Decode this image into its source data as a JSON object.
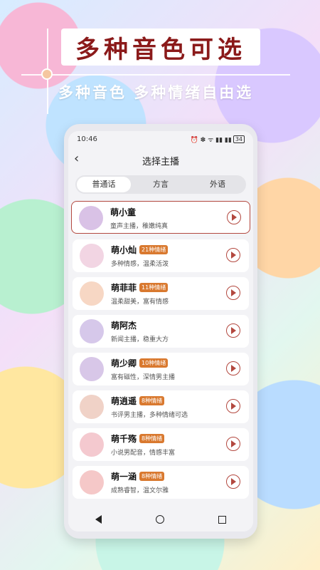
{
  "hero": {
    "title": "多种音色可选",
    "subtitle": "多种音色  多种情绪自由选"
  },
  "status_bar": {
    "time": "10:46",
    "icons": "⏰ ✽ ᯤ ▮▮ ▮▮",
    "battery": "34"
  },
  "nav": {
    "title": "选择主播",
    "back_icon": "‹"
  },
  "tabs": [
    {
      "label": "普通话",
      "active": true
    },
    {
      "label": "方言",
      "active": false
    },
    {
      "label": "外语",
      "active": false
    }
  ],
  "anchors": [
    {
      "name": "萌小童",
      "badge": "",
      "desc": "童声主播，稚嫩纯真",
      "selected": true
    },
    {
      "name": "萌小灿",
      "badge": "21种情绪",
      "desc": "多种情感，温柔活泼",
      "selected": false
    },
    {
      "name": "萌菲菲",
      "badge": "11种情绪",
      "desc": "温柔甜美，富有情感",
      "selected": false
    },
    {
      "name": "萌阿杰",
      "badge": "",
      "desc": "新闻主播，稳重大方",
      "selected": false
    },
    {
      "name": "萌少卿",
      "badge": "10种情绪",
      "desc": "富有磁性，深情男主播",
      "selected": false
    },
    {
      "name": "萌逍遥",
      "badge": "8种情绪",
      "desc": "书评男主播，多种情绪可选",
      "selected": false
    },
    {
      "name": "萌千殇",
      "badge": "8种情绪",
      "desc": "小说男配音，情感丰富",
      "selected": false
    },
    {
      "name": "萌一涵",
      "badge": "8种情绪",
      "desc": "成熟睿智，温文尔雅",
      "selected": false
    }
  ],
  "colors": {
    "accent": "#b3483f",
    "badge": "#d9792f",
    "hero_title": "#8b1a1a"
  }
}
